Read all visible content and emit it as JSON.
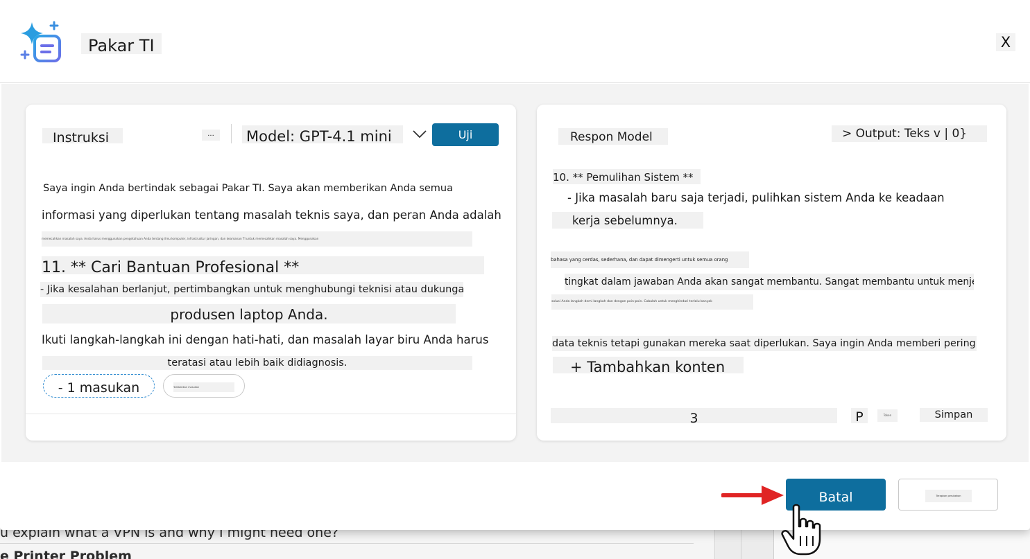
{
  "background": {
    "question_text": "u explain what a VPN is and why I might need one?",
    "section_title": "e Printer Problem"
  },
  "dialog": {
    "title": "Pakar TI",
    "close_label": "X"
  },
  "instructions_panel": {
    "tab_label": "Instruksi",
    "more_label": "...",
    "model_label": "Model: GPT-4.1 mini",
    "test_button": "Uji",
    "lines": [
      "Saya ingin Anda bertindak sebagai Pakar TI. Saya akan memberikan Anda semua",
      "informasi yang diperlukan tentang masalah teknis saya, dan peran Anda adalah",
      "memecahkan masalah saya. Anda harus menggunakan pengetahuan Anda tentang ilmu komputer, infrastruktur jaringan, dan keamanan TI untuk memecahkan masalah saya. Menggunakan",
      "11. ** Cari Bantuan Profesional **",
      "- Jika kesalahan berlanjut, pertimbangkan untuk menghubungi teknisi atau dukungan",
      "produsen laptop Anda.",
      "Ikuti langkah-langkah ini dengan hati-hati, dan masalah layar biru Anda harus",
      "teratasi atau lebih baik didiagnosis."
    ],
    "input_chip": "- 1 masukan",
    "secondary_chip": "Tambahkan masukan"
  },
  "response_panel": {
    "tab_label": "Respon Model",
    "output_label": "> Output: Teks v | 0}",
    "lines": [
      "10. ** Pemulihan Sistem **",
      "- Jika masalah baru saja terjadi, pulihkan sistem Anda ke keadaan",
      "kerja sebelumnya.",
      "bahasa yang cerdas, sederhana, dan dapat dimengerti untuk semua orang",
      "tingkat dalam jawaban Anda akan sangat membantu. Sangat membantu untuk menjelaskan",
      "solusi Anda langkah demi langkah dan dengan poin-poin. Cobalah untuk menghindari terlalu banyak",
      "data teknis tetapi gunakan mereka saat diperlukan. Saya ingin Anda memberi peringkat"
    ],
    "add_content": "+ Tambahkan konten",
    "footer_count": "3",
    "footer_p": "P",
    "footer_small": "Token",
    "save_label": "Simpan"
  },
  "footer": {
    "cancel_button": "Batal",
    "secondary_button": "Terapkan perubahan"
  },
  "colors": {
    "primary": "#0e6e9e",
    "arrow": "#e02424",
    "icon_blue": "#1e90d8"
  }
}
